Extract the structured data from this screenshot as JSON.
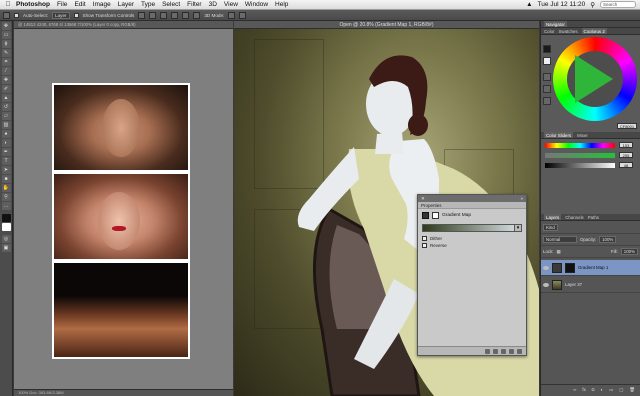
{
  "menubar": {
    "apple": "",
    "app": "Photoshop",
    "items": [
      "File",
      "Edit",
      "Image",
      "Layer",
      "Type",
      "Select",
      "Filter",
      "3D",
      "View",
      "Window",
      "Help"
    ],
    "clock": "Tue Jul 12  11:20",
    "search_placeholder": "Search"
  },
  "options_bar": {
    "auto_select_label": "Auto-Select:",
    "auto_select_value": "Layer",
    "show_transform_label": "Show Transform Controls",
    "mode_3d_label": "3D Mode:"
  },
  "doc1": {
    "title": "@ 14813 4240, 6768 4/ 13568 7/100% (Layer 0 copy, RGB/8)",
    "status": "100%   Doc: 393.8K/3.38M"
  },
  "doc2": {
    "title": "Open @ 20.8% (Gradient Map 1, RGB/8#)",
    "status": "20.8%   Doc: 30.3M/60.6M"
  },
  "properties": {
    "header": "Properties",
    "close": "»",
    "layer_type": "Gradient Map",
    "dither_label": "Dither",
    "reverse_label": "Reverse"
  },
  "right_panels": {
    "navigator_tab": "Navigator",
    "color_tabs": [
      "Color",
      "Swatches",
      "Coolorus 2"
    ],
    "color_sliders_tabs": [
      "Color Sliders",
      "Mixer"
    ],
    "slider_values": [
      "153",
      "255",
      "48"
    ],
    "hex_value": "CF8001",
    "layers_tabs": [
      "Layers",
      "Channels",
      "Paths"
    ],
    "kind_label": "Kind",
    "blend_mode": "Normal",
    "opacity_label": "Opacity:",
    "opacity_value": "100%",
    "lock_label": "Lock:",
    "fill_label": "Fill:",
    "fill_value": "100%",
    "layers": [
      {
        "name": "Gradient Map 1"
      },
      {
        "name": "Layer 37"
      }
    ]
  },
  "colors": {
    "accent_green": "#2fb63a",
    "ui_dark": "#4c4c4c",
    "selected_layer": "#7b95c4"
  }
}
